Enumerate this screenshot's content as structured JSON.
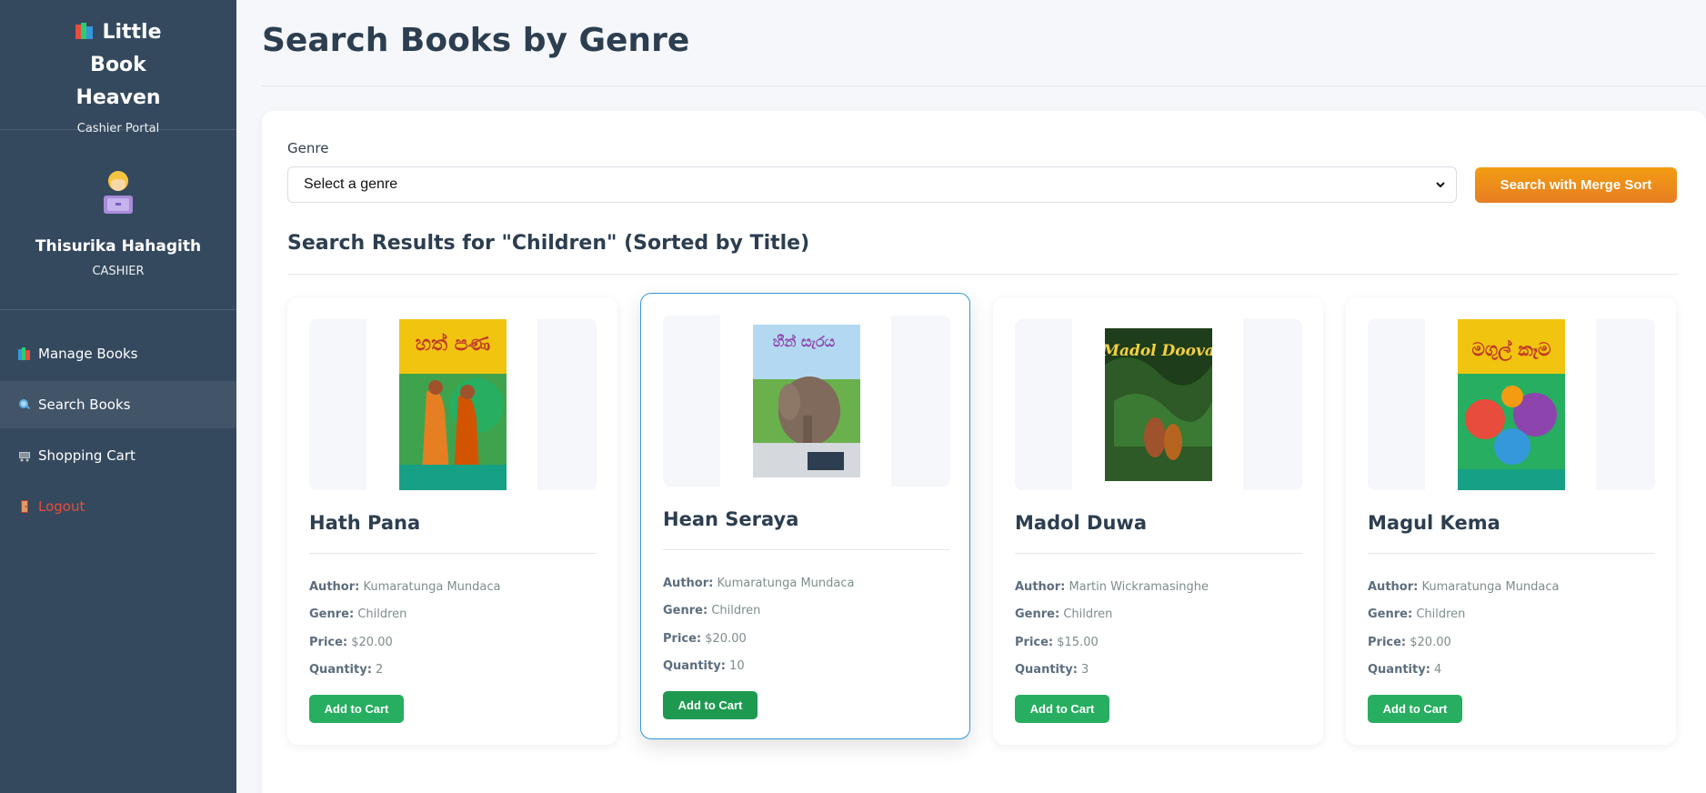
{
  "sidebar": {
    "brand_title": "Little Book Heaven",
    "brand_subtitle": "Cashier Portal",
    "user_name": "Thisurika Hahagith",
    "user_role": "CASHIER",
    "nav": [
      {
        "label": "Manage Books",
        "icon": "books-icon"
      },
      {
        "label": "Search Books",
        "icon": "search-icon"
      },
      {
        "label": "Shopping Cart",
        "icon": "cart-icon"
      },
      {
        "label": "Logout",
        "icon": "door-icon"
      }
    ]
  },
  "page": {
    "title": "Search Books by Genre"
  },
  "search": {
    "genre_label": "Genre",
    "select_value": "Select a genre",
    "button_label": "Search with Merge Sort"
  },
  "results": {
    "heading": "Search Results for \"Children\" (Sorted by Title)",
    "books": [
      {
        "title": "Hath Pana",
        "author_label": "Author:",
        "author": "Kumaratunga Mundaca",
        "genre_label": "Genre:",
        "genre": "Children",
        "price_label": "Price:",
        "price": "$20.00",
        "quantity_label": "Quantity:",
        "quantity": "2",
        "button": "Add to Cart",
        "cover_text": "හත් පණ"
      },
      {
        "title": "Hean Seraya",
        "author_label": "Author:",
        "author": "Kumaratunga Mundaca",
        "genre_label": "Genre:",
        "genre": "Children",
        "price_label": "Price:",
        "price": "$20.00",
        "quantity_label": "Quantity:",
        "quantity": "10",
        "button": "Add to Cart",
        "cover_text": "හීන් සැරය"
      },
      {
        "title": "Madol Duwa",
        "author_label": "Author:",
        "author": "Martin Wickramasinghe",
        "genre_label": "Genre:",
        "genre": "Children",
        "price_label": "Price:",
        "price": "$15.00",
        "quantity_label": "Quantity:",
        "quantity": "3",
        "button": "Add to Cart",
        "cover_text": "Madol Doova"
      },
      {
        "title": "Magul Kema",
        "author_label": "Author:",
        "author": "Kumaratunga Mundaca",
        "genre_label": "Genre:",
        "genre": "Children",
        "price_label": "Price:",
        "price": "$20.00",
        "quantity_label": "Quantity:",
        "quantity": "4",
        "button": "Add to Cart",
        "cover_text": "මගුල් කෑම"
      }
    ]
  },
  "colors": {
    "sidebar_bg": "#34495e",
    "accent_orange": "#e67e22",
    "accent_green": "#27ae60",
    "hover_border": "#3498db",
    "logout_red": "#e74c3c"
  }
}
